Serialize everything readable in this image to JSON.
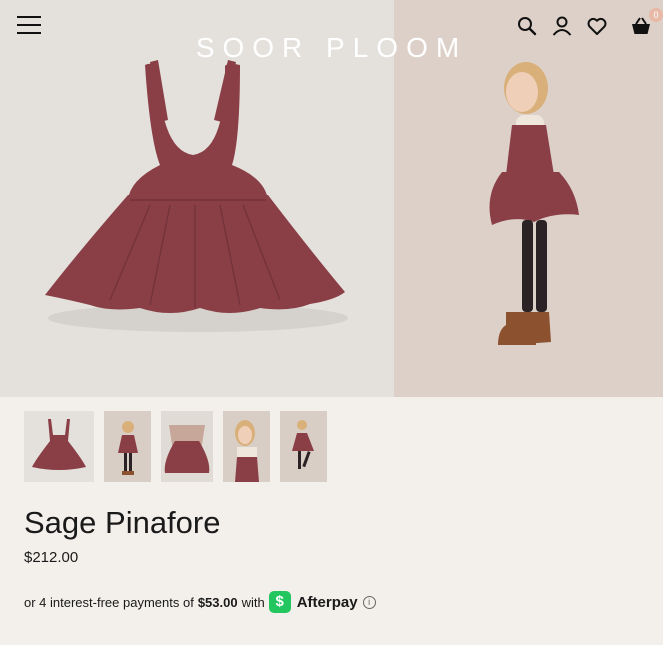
{
  "header": {
    "logo": "SOOR PLOOM",
    "cart_count": "0",
    "icons": [
      "menu-icon",
      "search-icon",
      "account-icon",
      "heart-icon",
      "basket-icon"
    ]
  },
  "product": {
    "title": "Sage Pinafore",
    "price": "$212.00"
  },
  "afterpay": {
    "prefix": "or 4 interest-free payments of",
    "amount": "$53.00",
    "with": "with",
    "badge": "$",
    "brand": "Afterpay",
    "info": "i"
  },
  "gallery": {
    "thumbnail_count": 5
  },
  "colors": {
    "background": "#f3f0eb",
    "dress": "#8a3f47",
    "afterpay_green": "#22c55e"
  }
}
